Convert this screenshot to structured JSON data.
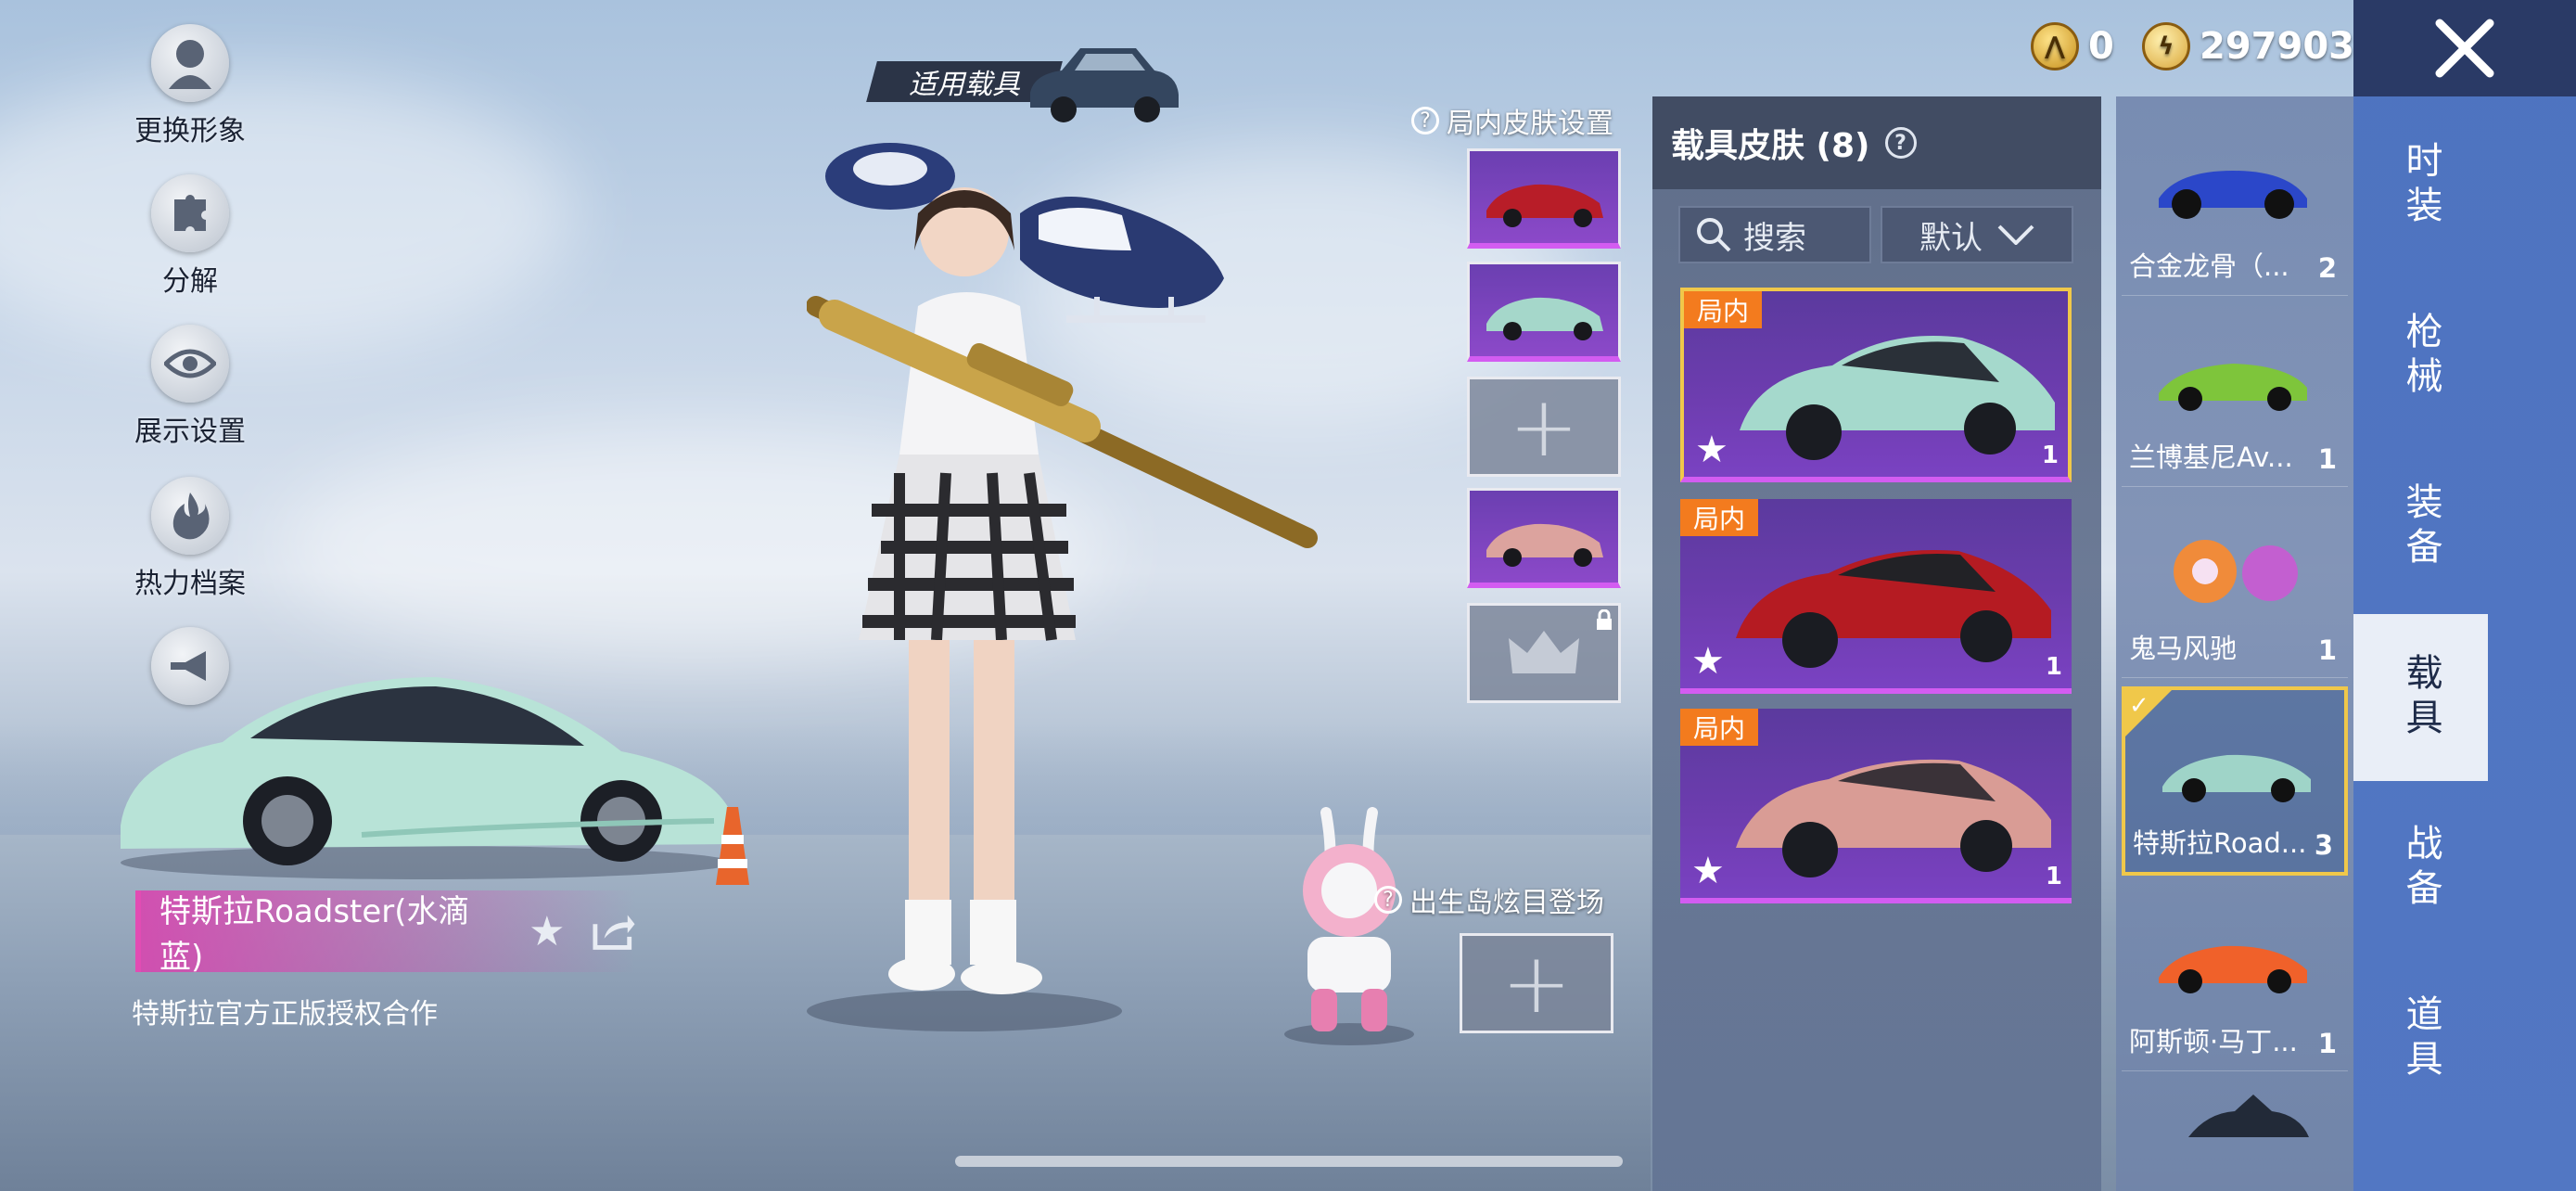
{
  "currency": {
    "coin1_value": "0",
    "coin2_value": "297903"
  },
  "left_menu": [
    {
      "label": "更换形象",
      "icon": "avatar-icon"
    },
    {
      "label": "分解",
      "icon": "puzzle-icon"
    },
    {
      "label": "展示设置",
      "icon": "eye-icon"
    },
    {
      "label": "热力档案",
      "icon": "flame-icon"
    },
    {
      "label": "",
      "icon": "trumpet-icon"
    }
  ],
  "applicable_vehicle_label": "适用载具",
  "in_match_skin": {
    "title": "局内皮肤设置",
    "slots": [
      "filled",
      "filled",
      "empty",
      "filled",
      "locked"
    ]
  },
  "spawn_island": {
    "title": "出生岛炫目登场"
  },
  "selected_item": {
    "name": "特斯拉Roadster(水滴蓝)",
    "subtitle": "特斯拉官方正版授权合作"
  },
  "skin_panel": {
    "title": "载具皮肤 (8)",
    "search_placeholder": "搜索",
    "sort_label": "默认",
    "cards": [
      {
        "tag": "局内",
        "count": "1",
        "color": "#9fd4c8"
      },
      {
        "tag": "局内",
        "count": "1",
        "color": "#b21d22"
      },
      {
        "tag": "局内",
        "count": "1",
        "color": "#d79a93"
      }
    ]
  },
  "vehicle_list": [
    {
      "name": "合金龙骨（...",
      "count": "2",
      "color": "#2b47c9"
    },
    {
      "name": "兰博基尼Av...",
      "count": "1",
      "color": "#7ec53b"
    },
    {
      "name": "鬼马风驰",
      "count": "1",
      "color": "#f08b3a"
    },
    {
      "name": "特斯拉Road...",
      "count": "3",
      "color": "#9fd4c8"
    },
    {
      "name": "阿斯顿·马丁...",
      "count": "1",
      "color": "#f0612a"
    }
  ],
  "tabs": [
    "时装",
    "枪械",
    "装备",
    "载具",
    "战备",
    "道具"
  ],
  "active_tab": "载具",
  "colors": {
    "accent_gold": "#f0c84a",
    "rare_purple": "#d35cf1",
    "tag_orange": "#f37b1e",
    "tab_blue": "#4e73c0"
  }
}
